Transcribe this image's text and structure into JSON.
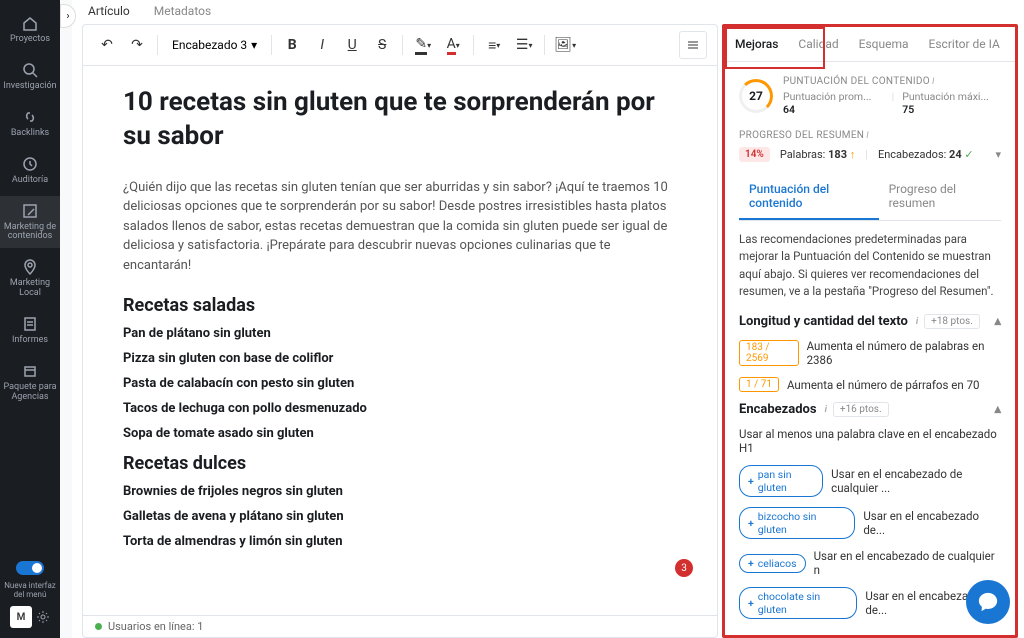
{
  "sidebar": {
    "items": [
      {
        "label": "Proyectos"
      },
      {
        "label": "Investigación"
      },
      {
        "label": "Backlinks"
      },
      {
        "label": "Auditoría"
      },
      {
        "label": "Marketing de contenidos"
      },
      {
        "label": "Marketing Local"
      },
      {
        "label": "Informes"
      },
      {
        "label": "Paquete para Agencias"
      }
    ],
    "newUiLabel": "Nueva interfaz del menú",
    "avatar": "M"
  },
  "topTabs": {
    "article": "Artículo",
    "metadata": "Metadatos"
  },
  "toolbar": {
    "undo": "undo",
    "redo": "redo",
    "heading": "Encabezado 3",
    "bold": "B",
    "italic": "I",
    "underline": "U",
    "strike": "S"
  },
  "article": {
    "title": "10 recetas sin gluten que te sorprenderán por su sabor",
    "intro": "¿Quién dijo que las recetas sin gluten tenían que ser aburridas y sin sabor? ¡Aquí te traemos 10 deliciosas opciones que te sorprenderán por su sabor! Desde postres irresistibles hasta platos salados llenos de sabor, estas recetas demuestran que la comida sin gluten puede ser igual de deliciosa y satisfactoria. ¡Prepárate para descubrir nuevas opciones culinarias que te encantarán!",
    "h2a": "Recetas saladas",
    "h3a1": "Pan de plátano sin gluten",
    "h3a2": "Pizza sin gluten con base de coliflor",
    "h3a3": "Pasta de calabacín con pesto sin gluten",
    "h3a4": "Tacos de lechuga con pollo desmenuzado",
    "h3a5": "Sopa de tomate asado sin gluten",
    "h2b": "Recetas dulces",
    "h3b1": "Brownies de frijoles negros sin gluten",
    "h3b2": "Galletas de avena y plátano sin gluten",
    "h3b3": "Torta de almendras y limón sin gluten",
    "errorCount": "3"
  },
  "footer": {
    "online": "Usuarios en línea: 1"
  },
  "panel": {
    "tabs": {
      "improvements": "Mejoras",
      "quality": "Calidad",
      "outline": "Esquema",
      "ai": "Escritor de IA"
    },
    "scoreTitle": "PUNTUACIÓN DEL CONTENIDO",
    "score": "27",
    "avgLabel": "Puntuación prom...",
    "avg": "64",
    "maxLabel": "Puntuación máxi...",
    "max": "75",
    "progressTitle": "PROGRESO DEL RESUMEN",
    "pct": "14%",
    "wordsLabel": "Palabras:",
    "words": "183",
    "headingsLabel": "Encabezados:",
    "headings": "24",
    "subtabs": {
      "score": "Puntuación del contenido",
      "progress": "Progreso del resumen"
    },
    "desc": "Las recomendaciones predeterminadas para mejorar la Puntuación del Contenido se muestran aquí abajo. Si quieres ver recomendaciones del resumen, ve a la pestaña \"Progreso del Resumen\".",
    "lenTitle": "Longitud y cantidad del texto",
    "lenPts": "+18 ptos.",
    "rec1Badge": "183 / 2569",
    "rec1": "Aumenta el número de palabras en 2386",
    "rec2Badge": "1 / 71",
    "rec2": "Aumenta el número de párrafos en 70",
    "hdTitle": "Encabezados",
    "hdPts": "+16 ptos.",
    "hdIntro": "Usar al menos una palabra clave en el encabezado H1",
    "kw1": "pan sin gluten",
    "kw1txt": "Usar en el encabezado de cualquier ...",
    "kw2": "bizcocho sin gluten",
    "kw2txt": "Usar en el encabezado de...",
    "kw3": "celiacos",
    "kw3txt": "Usar en el encabezado de cualquier n",
    "kw4": "chocolate sin gluten",
    "kw4txt": "Usar en el encabezado de..."
  }
}
